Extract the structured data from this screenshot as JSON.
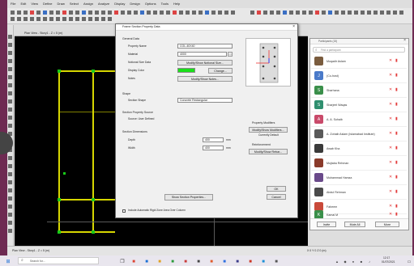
{
  "app": {
    "menu": [
      "File",
      "Edit",
      "View",
      "Define",
      "Draw",
      "Select",
      "Assign",
      "Analyze",
      "Display",
      "Design",
      "Options",
      "Tools",
      "Help"
    ],
    "model_tab": "Plan View - Story1 - Z = 5 (m)",
    "status_left": "Plan View - Story1 - Z = 5 (m)",
    "status_right": "X 0  Y 0  Z 0  (m)"
  },
  "dialog": {
    "title": "Frame Section Property Data",
    "general_legend": "General Data",
    "labels": {
      "property_name": "Property Name",
      "material": "Material",
      "notional_size": "Notional Size Data",
      "display_color": "Display Color",
      "notes": "Notes"
    },
    "values": {
      "property_name": "COL-40X40",
      "material": "4000"
    },
    "buttons": {
      "modify_notional": "Modify/Show Notional Size...",
      "change": "Change...",
      "modify_notes": "Modify/Show Notes...",
      "modify_modifiers": "Modify/Show Modifiers...",
      "modify_rebar": "Modify/Show Rebar...",
      "show_section": "Show Section Properties...",
      "ok": "OK",
      "cancel": "Cancel"
    },
    "shape_legend": "Shape",
    "shape_label": "Section Shape",
    "shape_value": "Concrete Rectangular",
    "section_source_legend": "Section Property Source",
    "section_source_text": "Source: User Defined",
    "dimensions_legend": "Section Dimensions",
    "dim_labels": {
      "depth": "Depth",
      "width": "Width"
    },
    "dim_values": {
      "depth": "400",
      "width": "400"
    },
    "dim_units": {
      "depth": "mm",
      "width": "mm"
    },
    "property_modifiers_legend": "Property Modifiers",
    "modifiers_status": "Currently Default",
    "reinforcement_legend": "Reinforcement",
    "checkbox_label": "Include Automatic Rigid Zone Area Over Column"
  },
  "participants": {
    "title": "Participants (15)",
    "search_placeholder": "Find a participant",
    "people": [
      {
        "initial": "",
        "name": "Muqadir Aslam",
        "color": "#7a5c3e"
      },
      {
        "initial": "J",
        "name": "(Co-host)",
        "color": "#4a7ac9"
      },
      {
        "initial": "S",
        "name": "Sharhana",
        "color": "#3a8f4a"
      },
      {
        "initial": "S",
        "name": "Sharjeel Waqas",
        "color": "#2f8f6f"
      },
      {
        "initial": "A",
        "name": "A. A. Sohaib",
        "color": "#c94a6a"
      },
      {
        "initial": "",
        "name": "A. Zohaib Aslam (Islamabad Institute)",
        "color": "#5a5a5a"
      },
      {
        "initial": "",
        "name": "Awab Kha",
        "color": "#3a3a3a"
      },
      {
        "initial": "",
        "name": "Mujtaba Rehman",
        "color": "#8a3a2a"
      },
      {
        "initial": "",
        "name": "Muhammad Hamza",
        "color": "#6a4a8a"
      },
      {
        "initial": "",
        "name": "Abdul Rehman",
        "color": "#4a4a4a"
      },
      {
        "initial": "",
        "name": "Faheem",
        "color": "#c94a3a"
      },
      {
        "initial": "K",
        "name": "Kamal M",
        "color": "#3a8f4a"
      }
    ],
    "footer_buttons": [
      "Invite",
      "Mute All",
      "More"
    ]
  },
  "taskbar": {
    "search_text": "Search for...",
    "clock_time": "12:17",
    "clock_date": "01/07/2021"
  }
}
